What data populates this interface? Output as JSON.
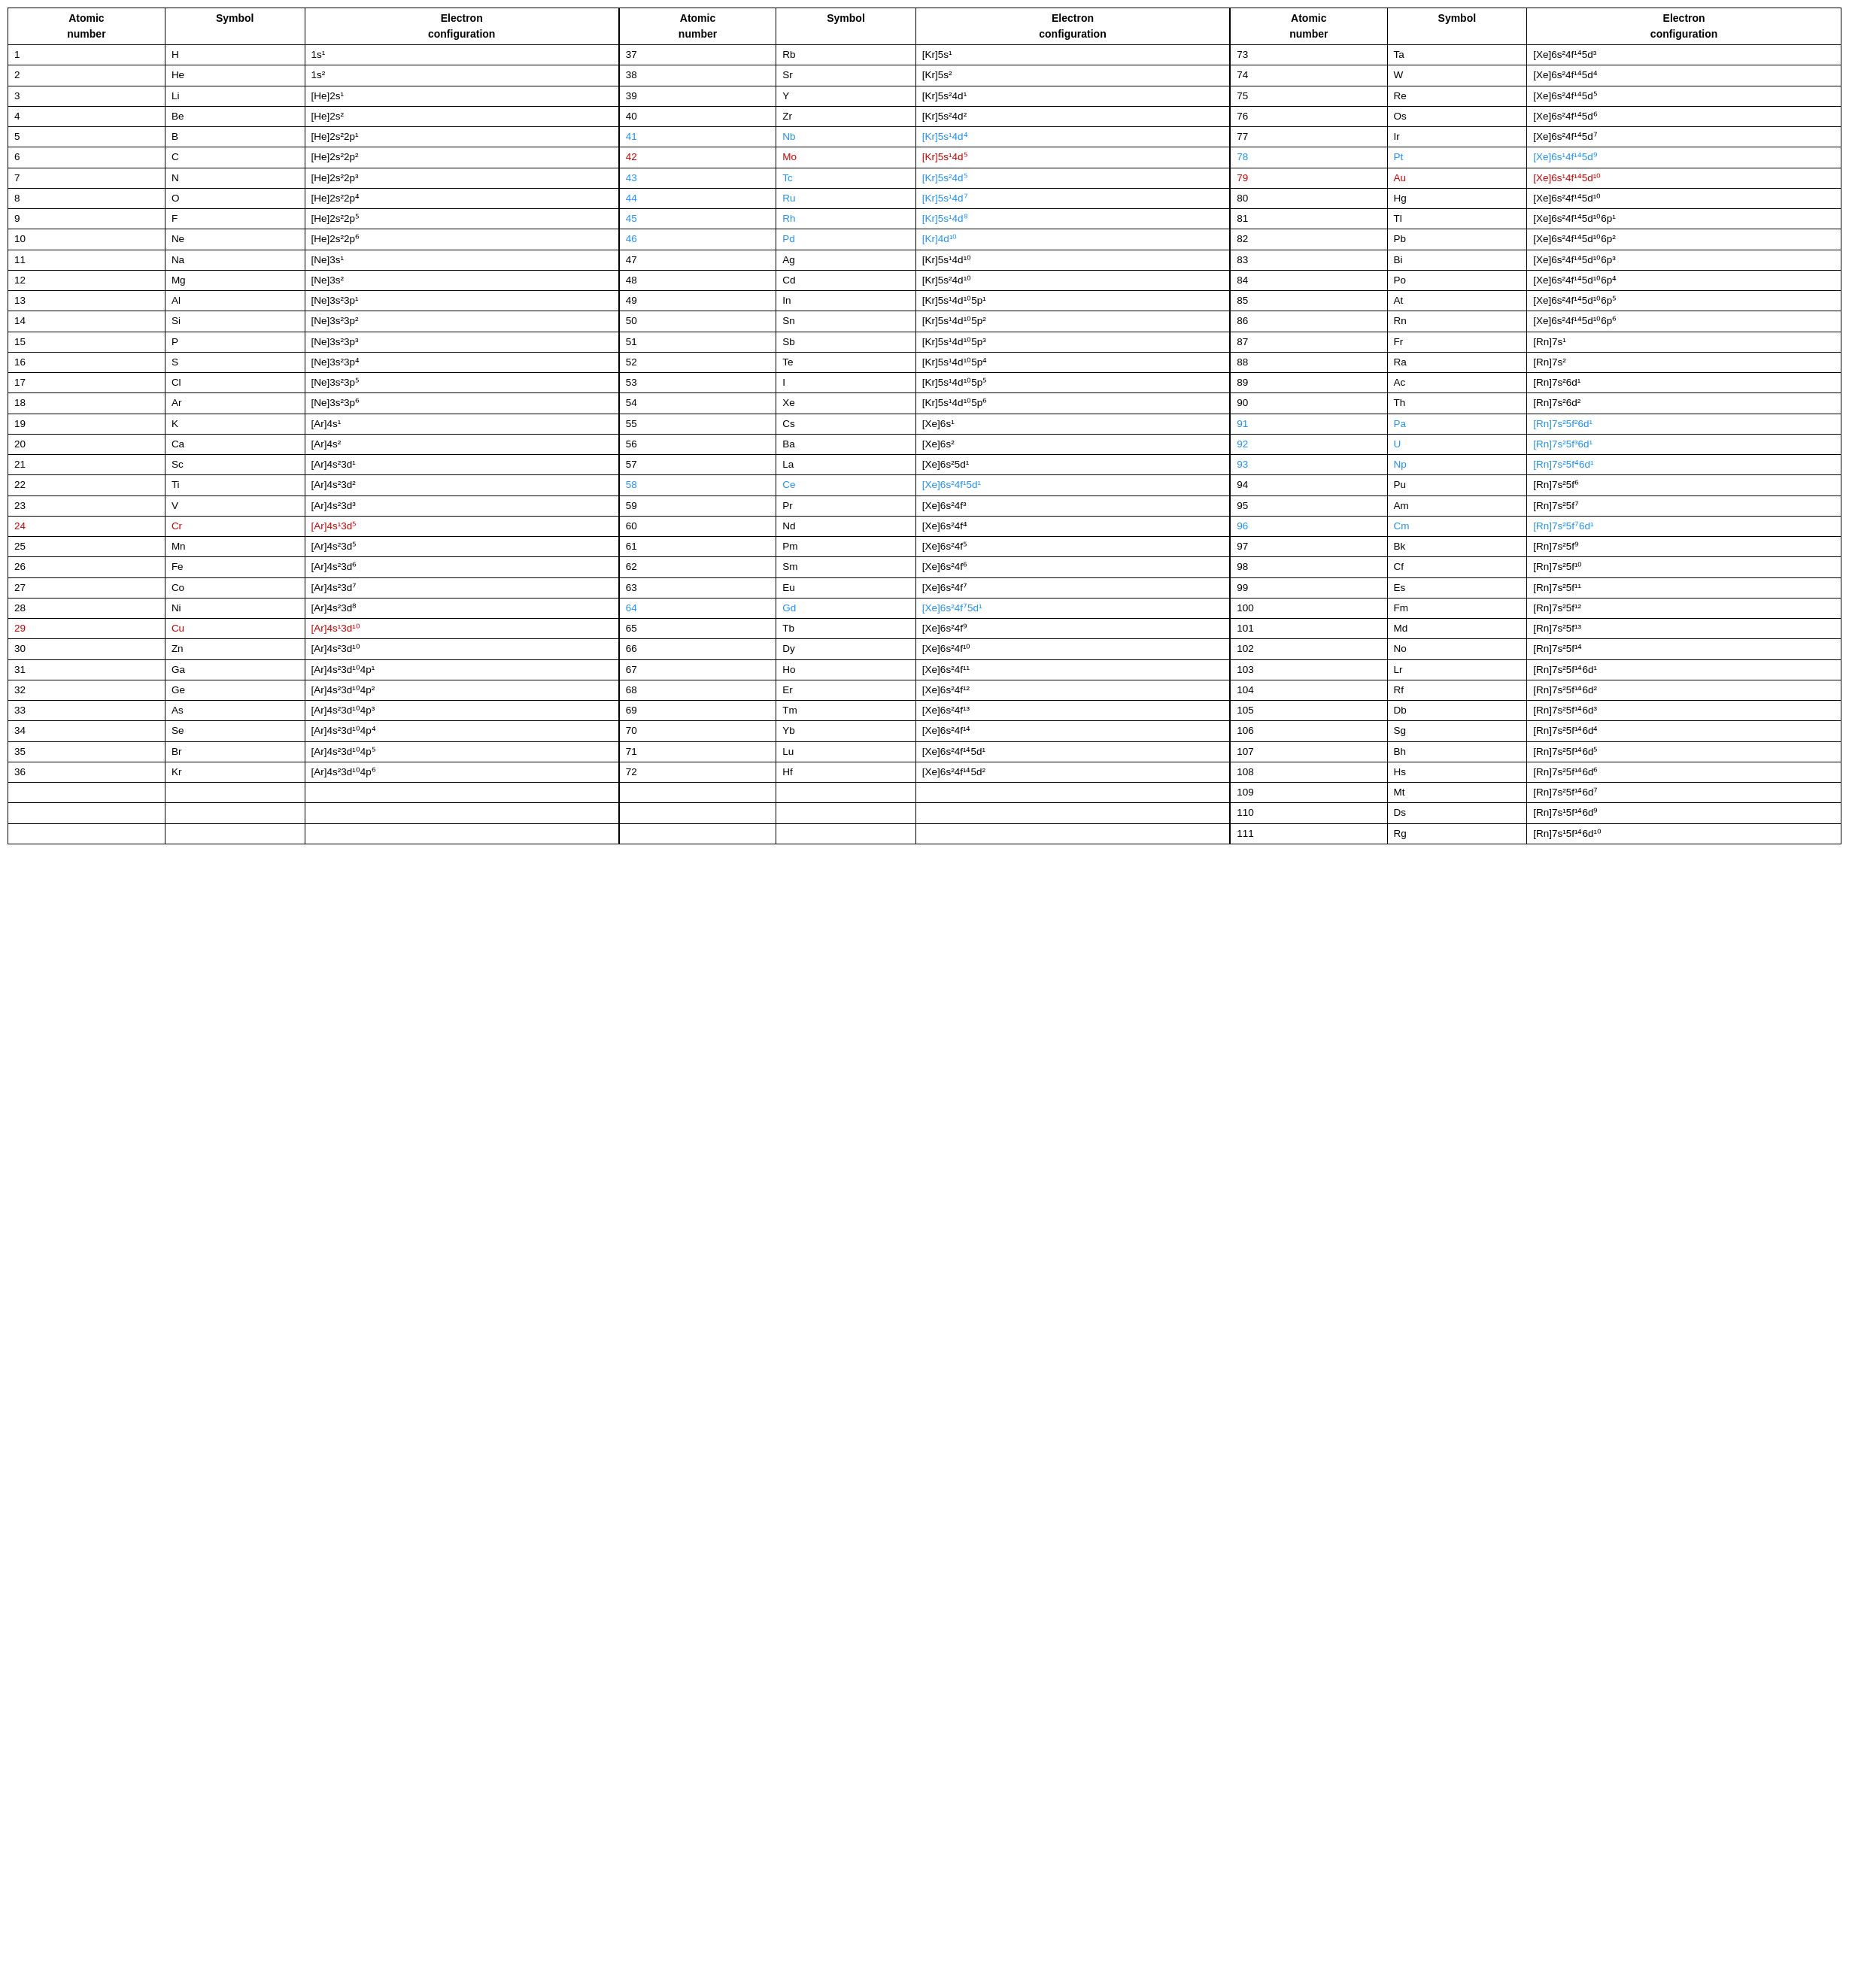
{
  "table": {
    "headers": [
      "Atomic number",
      "Symbol",
      "Electron configuration",
      "Atomic number",
      "Symbol",
      "Electron configuration",
      "Atomic number",
      "Symbol",
      "Electron configuration"
    ],
    "rows": [
      {
        "an1": "1",
        "sym1": "H",
        "ec1": "1s¹",
        "an2": "37",
        "sym2": "Rb",
        "ec2": "[Kr]5s¹",
        "an3": "73",
        "sym3": "Ta",
        "ec3": "[Xe]6s²4f¹⁴5d³",
        "c1": "",
        "c2": "",
        "c3": ""
      },
      {
        "an1": "2",
        "sym1": "He",
        "ec1": "1s²",
        "an2": "38",
        "sym2": "Sr",
        "ec2": "[Kr]5s²",
        "an3": "74",
        "sym3": "W",
        "ec3": "[Xe]6s²4f¹⁴5d⁴",
        "c1": "",
        "c2": "",
        "c3": ""
      },
      {
        "an1": "3",
        "sym1": "Li",
        "ec1": "[He]2s¹",
        "an2": "39",
        "sym2": "Y",
        "ec2": "[Kr]5s²4d¹",
        "an3": "75",
        "sym3": "Re",
        "ec3": "[Xe]6s²4f¹⁴5d⁵",
        "c1": "",
        "c2": "",
        "c3": ""
      },
      {
        "an1": "4",
        "sym1": "Be",
        "ec1": "[He]2s²",
        "an2": "40",
        "sym2": "Zr",
        "ec2": "[Kr]5s²4d²",
        "an3": "76",
        "sym3": "Os",
        "ec3": "[Xe]6s²4f¹⁴5d⁶",
        "c1": "",
        "c2": "",
        "c3": ""
      },
      {
        "an1": "5",
        "sym1": "B",
        "ec1": "[He]2s²2p¹",
        "an2": "41",
        "sym2": "Nb",
        "ec2": "[Kr]5s¹4d⁴",
        "an3": "77",
        "sym3": "Ir",
        "ec3": "[Xe]6s²4f¹⁴5d⁷",
        "c1": "",
        "c2": "blue",
        "c3": ""
      },
      {
        "an1": "6",
        "sym1": "C",
        "ec1": "[He]2s²2p²",
        "an2": "42",
        "sym2": "Mo",
        "ec2": "[Kr]5s¹4d⁵",
        "an3": "78",
        "sym3": "Pt",
        "ec3": "[Xe]6s¹4f¹⁴5d⁹",
        "c1": "",
        "c2": "red",
        "c3": "blue",
        "c3sym": "blue"
      },
      {
        "an1": "7",
        "sym1": "N",
        "ec1": "[He]2s²2p³",
        "an2": "43",
        "sym2": "Tc",
        "ec2": "[Kr]5s²4d⁵",
        "an3": "79",
        "sym3": "Au",
        "ec3": "[Xe]6s¹4f¹⁴5d¹⁰",
        "c1": "",
        "c2": "blue",
        "c3": "red",
        "c3sym": "red"
      },
      {
        "an1": "8",
        "sym1": "O",
        "ec1": "[He]2s²2p⁴",
        "an2": "44",
        "sym2": "Ru",
        "ec2": "[Kr]5s¹4d⁷",
        "an3": "80",
        "sym3": "Hg",
        "ec3": "[Xe]6s²4f¹⁴5d¹⁰",
        "c1": "",
        "c2": "blue",
        "c3": ""
      },
      {
        "an1": "9",
        "sym1": "F",
        "ec1": "[He]2s²2p⁵",
        "an2": "45",
        "sym2": "Rh",
        "ec2": "[Kr]5s¹4d⁸",
        "an3": "81",
        "sym3": "Tl",
        "ec3": "[Xe]6s²4f¹⁴5d¹⁰6p¹",
        "c1": "",
        "c2": "blue",
        "c3": ""
      },
      {
        "an1": "10",
        "sym1": "Ne",
        "ec1": "[He]2s²2p⁶",
        "an2": "46",
        "sym2": "Pd",
        "ec2": "[Kr]4d¹⁰",
        "an3": "82",
        "sym3": "Pb",
        "ec3": "[Xe]6s²4f¹⁴5d¹⁰6p²",
        "c1": "",
        "c2": "blue",
        "c3": ""
      },
      {
        "an1": "11",
        "sym1": "Na",
        "ec1": "[Ne]3s¹",
        "an2": "47",
        "sym2": "Ag",
        "ec2": "[Kr]5s¹4d¹⁰",
        "an3": "83",
        "sym3": "Bi",
        "ec3": "[Xe]6s²4f¹⁴5d¹⁰6p³",
        "c1": "",
        "c2": "",
        "c3": ""
      },
      {
        "an1": "12",
        "sym1": "Mg",
        "ec1": "[Ne]3s²",
        "an2": "48",
        "sym2": "Cd",
        "ec2": "[Kr]5s²4d¹⁰",
        "an3": "84",
        "sym3": "Po",
        "ec3": "[Xe]6s²4f¹⁴5d¹⁰6p⁴",
        "c1": "",
        "c2": "",
        "c3": ""
      },
      {
        "an1": "13",
        "sym1": "Al",
        "ec1": "[Ne]3s²3p¹",
        "an2": "49",
        "sym2": "In",
        "ec2": "[Kr]5s¹4d¹⁰5p¹",
        "an3": "85",
        "sym3": "At",
        "ec3": "[Xe]6s²4f¹⁴5d¹⁰6p⁵",
        "c1": "",
        "c2": "",
        "c3": ""
      },
      {
        "an1": "14",
        "sym1": "Si",
        "ec1": "[Ne]3s²3p²",
        "an2": "50",
        "sym2": "Sn",
        "ec2": "[Kr]5s¹4d¹⁰5p²",
        "an3": "86",
        "sym3": "Rn",
        "ec3": "[Xe]6s²4f¹⁴5d¹⁰6p⁶",
        "c1": "",
        "c2": "",
        "c3": ""
      },
      {
        "an1": "15",
        "sym1": "P",
        "ec1": "[Ne]3s²3p³",
        "an2": "51",
        "sym2": "Sb",
        "ec2": "[Kr]5s¹4d¹⁰5p³",
        "an3": "87",
        "sym3": "Fr",
        "ec3": "[Rn]7s¹",
        "c1": "",
        "c2": "",
        "c3": ""
      },
      {
        "an1": "16",
        "sym1": "S",
        "ec1": "[Ne]3s²3p⁴",
        "an2": "52",
        "sym2": "Te",
        "ec2": "[Kr]5s¹4d¹⁰5p⁴",
        "an3": "88",
        "sym3": "Ra",
        "ec3": "[Rn]7s²",
        "c1": "",
        "c2": "",
        "c3": ""
      },
      {
        "an1": "17",
        "sym1": "Cl",
        "ec1": "[Ne]3s²3p⁵",
        "an2": "53",
        "sym2": "I",
        "ec2": "[Kr]5s¹4d¹⁰5p⁵",
        "an3": "89",
        "sym3": "Ac",
        "ec3": "[Rn]7s²6d¹",
        "c1": "",
        "c2": "",
        "c3": ""
      },
      {
        "an1": "18",
        "sym1": "Ar",
        "ec1": "[Ne]3s²3p⁶",
        "an2": "54",
        "sym2": "Xe",
        "ec2": "[Kr]5s¹4d¹⁰5p⁶",
        "an3": "90",
        "sym3": "Th",
        "ec3": "[Rn]7s²6d²",
        "c1": "",
        "c2": "",
        "c3": ""
      },
      {
        "an1": "19",
        "sym1": "K",
        "ec1": "[Ar]4s¹",
        "an2": "55",
        "sym2": "Cs",
        "ec2": "[Xe]6s¹",
        "an3": "91",
        "sym3": "Pa",
        "ec3": "[Rn]7s²5f²6d¹",
        "c1": "",
        "c2": "",
        "c3": "blue",
        "c3sym": "blue"
      },
      {
        "an1": "20",
        "sym1": "Ca",
        "ec1": "[Ar]4s²",
        "an2": "56",
        "sym2": "Ba",
        "ec2": "[Xe]6s²",
        "an3": "92",
        "sym3": "U",
        "ec3": "[Rn]7s²5f³6d¹",
        "c1": "",
        "c2": "",
        "c3": "blue",
        "c3sym": "blue"
      },
      {
        "an1": "21",
        "sym1": "Sc",
        "ec1": "[Ar]4s²3d¹",
        "an2": "57",
        "sym2": "La",
        "ec2": "[Xe]6s²5d¹",
        "an3": "93",
        "sym3": "Np",
        "ec3": "[Rn]7s²5f⁴6d¹",
        "c1": "",
        "c2": "",
        "c3": "blue",
        "c3sym": "blue"
      },
      {
        "an1": "22",
        "sym1": "Ti",
        "ec1": "[Ar]4s²3d²",
        "an2": "58",
        "sym2": "Ce",
        "ec2": "[Xe]6s²4f¹5d¹",
        "an3": "94",
        "sym3": "Pu",
        "ec3": "[Rn]7s²5f⁶",
        "c1": "",
        "c2": "blue",
        "c3": ""
      },
      {
        "an1": "23",
        "sym1": "V",
        "ec1": "[Ar]4s²3d³",
        "an2": "59",
        "sym2": "Pr",
        "ec2": "[Xe]6s²4f³",
        "an3": "95",
        "sym3": "Am",
        "ec3": "[Rn]7s²5f⁷",
        "c1": "",
        "c2": "",
        "c3": ""
      },
      {
        "an1": "24",
        "sym1": "Cr",
        "ec1": "[Ar]4s¹3d⁵",
        "an2": "60",
        "sym2": "Nd",
        "ec2": "[Xe]6s²4f⁴",
        "an3": "96",
        "sym3": "Cm",
        "ec3": "[Rn]7s²5f⁷6d¹",
        "c1": "red",
        "c2": "",
        "c3": "blue",
        "c3sym": "blue"
      },
      {
        "an1": "25",
        "sym1": "Mn",
        "ec1": "[Ar]4s²3d⁵",
        "an2": "61",
        "sym2": "Pm",
        "ec2": "[Xe]6s²4f⁵",
        "an3": "97",
        "sym3": "Bk",
        "ec3": "[Rn]7s²5f⁹",
        "c1": "",
        "c2": "",
        "c3": ""
      },
      {
        "an1": "26",
        "sym1": "Fe",
        "ec1": "[Ar]4s²3d⁶",
        "an2": "62",
        "sym2": "Sm",
        "ec2": "[Xe]6s²4f⁶",
        "an3": "98",
        "sym3": "Cf",
        "ec3": "[Rn]7s²5f¹⁰",
        "c1": "",
        "c2": "",
        "c3": ""
      },
      {
        "an1": "27",
        "sym1": "Co",
        "ec1": "[Ar]4s²3d⁷",
        "an2": "63",
        "sym2": "Eu",
        "ec2": "[Xe]6s²4f⁷",
        "an3": "99",
        "sym3": "Es",
        "ec3": "[Rn]7s²5f¹¹",
        "c1": "",
        "c2": "",
        "c3": ""
      },
      {
        "an1": "28",
        "sym1": "Ni",
        "ec1": "[Ar]4s²3d⁸",
        "an2": "64",
        "sym2": "Gd",
        "ec2": "[Xe]6s²4f⁷5d¹",
        "an3": "100",
        "sym3": "Fm",
        "ec3": "[Rn]7s²5f¹²",
        "c1": "",
        "c2": "blue",
        "c3": ""
      },
      {
        "an1": "29",
        "sym1": "Cu",
        "ec1": "[Ar]4s¹3d¹⁰",
        "an2": "65",
        "sym2": "Tb",
        "ec2": "[Xe]6s²4f⁹",
        "an3": "101",
        "sym3": "Md",
        "ec3": "[Rn]7s²5f¹³",
        "c1": "red",
        "c2": "",
        "c3": ""
      },
      {
        "an1": "30",
        "sym1": "Zn",
        "ec1": "[Ar]4s²3d¹⁰",
        "an2": "66",
        "sym2": "Dy",
        "ec2": "[Xe]6s²4f¹⁰",
        "an3": "102",
        "sym3": "No",
        "ec3": "[Rn]7s²5f¹⁴",
        "c1": "",
        "c2": "",
        "c3": ""
      },
      {
        "an1": "31",
        "sym1": "Ga",
        "ec1": "[Ar]4s²3d¹⁰4p¹",
        "an2": "67",
        "sym2": "Ho",
        "ec2": "[Xe]6s²4f¹¹",
        "an3": "103",
        "sym3": "Lr",
        "ec3": "[Rn]7s²5f¹⁴6d¹",
        "c1": "",
        "c2": "",
        "c3": ""
      },
      {
        "an1": "32",
        "sym1": "Ge",
        "ec1": "[Ar]4s²3d¹⁰4p²",
        "an2": "68",
        "sym2": "Er",
        "ec2": "[Xe]6s²4f¹²",
        "an3": "104",
        "sym3": "Rf",
        "ec3": "[Rn]7s²5f¹⁴6d²",
        "c1": "",
        "c2": "",
        "c3": ""
      },
      {
        "an1": "33",
        "sym1": "As",
        "ec1": "[Ar]4s²3d¹⁰4p³",
        "an2": "69",
        "sym2": "Tm",
        "ec2": "[Xe]6s²4f¹³",
        "an3": "105",
        "sym3": "Db",
        "ec3": "[Rn]7s²5f¹⁴6d³",
        "c1": "",
        "c2": "",
        "c3": ""
      },
      {
        "an1": "34",
        "sym1": "Se",
        "ec1": "[Ar]4s²3d¹⁰4p⁴",
        "an2": "70",
        "sym2": "Yb",
        "ec2": "[Xe]6s²4f¹⁴",
        "an3": "106",
        "sym3": "Sg",
        "ec3": "[Rn]7s²5f¹⁴6d⁴",
        "c1": "",
        "c2": "",
        "c3": ""
      },
      {
        "an1": "35",
        "sym1": "Br",
        "ec1": "[Ar]4s²3d¹⁰4p⁵",
        "an2": "71",
        "sym2": "Lu",
        "ec2": "[Xe]6s²4f¹⁴5d¹",
        "an3": "107",
        "sym3": "Bh",
        "ec3": "[Rn]7s²5f¹⁴6d⁵",
        "c1": "",
        "c2": "",
        "c3": ""
      },
      {
        "an1": "36",
        "sym1": "Kr",
        "ec1": "[Ar]4s²3d¹⁰4p⁶",
        "an2": "72",
        "sym2": "Hf",
        "ec2": "[Xe]6s²4f¹⁴5d²",
        "an3": "108",
        "sym3": "Hs",
        "ec3": "[Rn]7s²5f¹⁴6d⁶",
        "c1": "",
        "c2": "",
        "c3": ""
      },
      {
        "an1": "",
        "sym1": "",
        "ec1": "",
        "an2": "",
        "sym2": "",
        "ec2": "",
        "an3": "109",
        "sym3": "Mt",
        "ec3": "[Rn]7s²5f¹⁴6d⁷",
        "c1": "",
        "c2": "",
        "c3": ""
      },
      {
        "an1": "",
        "sym1": "",
        "ec1": "",
        "an2": "",
        "sym2": "",
        "ec2": "",
        "an3": "110",
        "sym3": "Ds",
        "ec3": "[Rn]7s¹5f¹⁴6d⁹",
        "c1": "",
        "c2": "",
        "c3": ""
      },
      {
        "an1": "",
        "sym1": "",
        "ec1": "",
        "an2": "",
        "sym2": "",
        "ec2": "",
        "an3": "111",
        "sym3": "Rg",
        "ec3": "[Rn]7s¹5f¹⁴6d¹⁰",
        "c1": "",
        "c2": "",
        "c3": ""
      }
    ]
  }
}
